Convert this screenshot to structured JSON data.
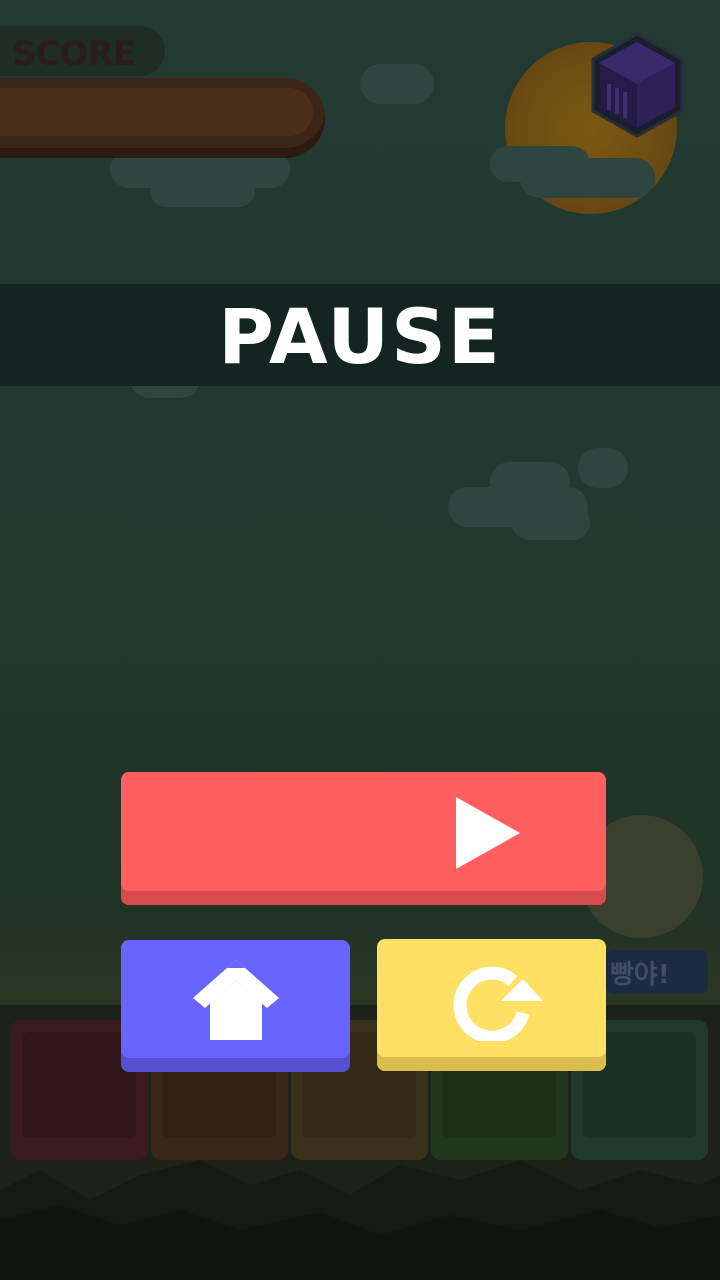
{
  "hud": {
    "score_label": "SCORE"
  },
  "overlay": {
    "title": "PAUSE"
  },
  "speech_bubble": {
    "text": "빵야!"
  },
  "buttons": {
    "resume": {
      "icon": "play-icon"
    },
    "home": {
      "icon": "home-icon"
    },
    "restart": {
      "icon": "restart-icon"
    }
  },
  "colors": {
    "resume": "#ff5f5f",
    "home": "#6963ff",
    "restart": "#ffe063",
    "overlay_band": "#142521",
    "blocks": [
      "#3a1a1a",
      "#3a2616",
      "#3a3216",
      "#22391c",
      "#1c3a2a"
    ]
  }
}
